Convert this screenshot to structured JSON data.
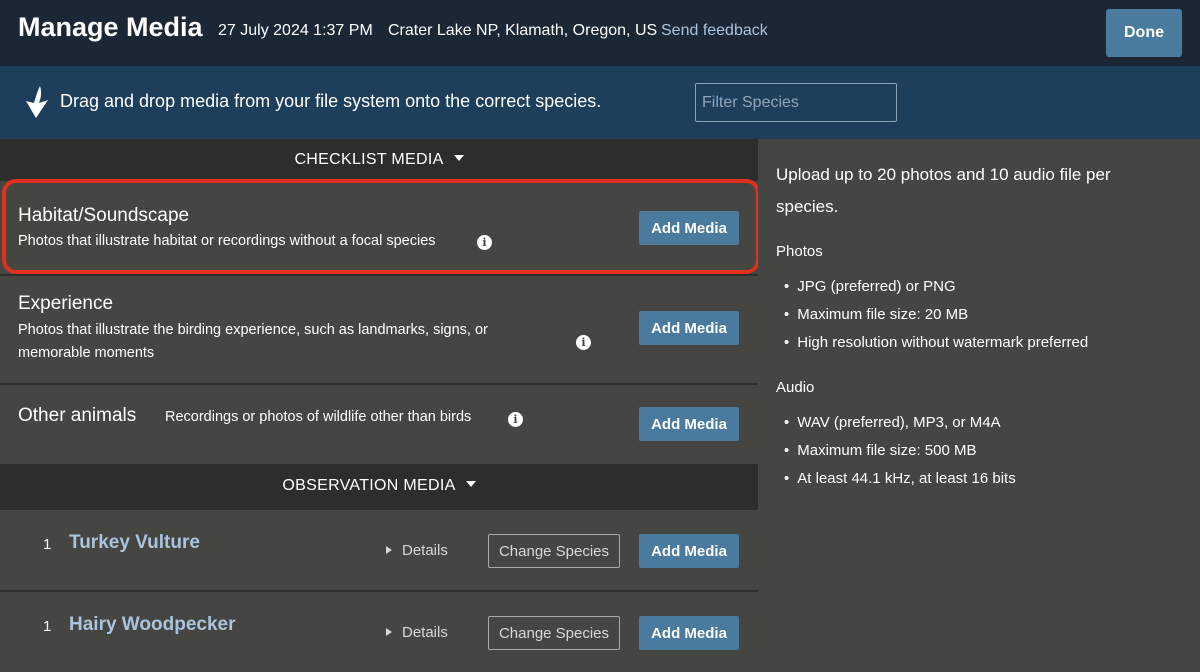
{
  "header": {
    "title": "Manage Media",
    "date": "27 July 2024 1:37 PM",
    "location": "Crater Lake NP, Klamath, Oregon, US",
    "feedback": "Send feedback",
    "done": "Done"
  },
  "dragbar": {
    "text": "Drag and drop media from your file system onto the correct species.",
    "filter_placeholder": "Filter Species"
  },
  "checklist_media": {
    "header": "CHECKLIST MEDIA",
    "rows": [
      {
        "title": "Habitat/Soundscape",
        "desc": "Photos that illustrate habitat or recordings without a focal species",
        "button": "Add Media"
      },
      {
        "title": "Experience",
        "desc": "Photos that illustrate the birding experience, such as landmarks, signs, or memorable moments",
        "button": "Add Media"
      },
      {
        "title": "Other animals",
        "desc": "Recordings or photos of wildlife other than birds",
        "button": "Add Media"
      }
    ]
  },
  "observation_media": {
    "header": "OBSERVATION MEDIA",
    "rows": [
      {
        "count": "1",
        "species": "Turkey Vulture",
        "details": "Details",
        "change": "Change Species",
        "button": "Add Media"
      },
      {
        "count": "1",
        "species": "Hairy Woodpecker",
        "details": "Details",
        "change": "Change Species",
        "button": "Add Media"
      }
    ]
  },
  "info_panel": {
    "intro": "Upload up to 20 photos and 10 audio file per species.",
    "photos_heading": "Photos",
    "photos": [
      "JPG (preferred) or PNG",
      "Maximum file size: 20 MB",
      "High resolution without watermark preferred"
    ],
    "audio_heading": "Audio",
    "audio": [
      "WAV (preferred), MP3, or M4A",
      "Maximum file size: 500 MB",
      "At least 44.1 kHz, at least 16 bits"
    ]
  },
  "colors": {
    "header_bg": "#1b2735",
    "dragbar_bg": "#1e3f5c",
    "button": "#4a7a9d",
    "link": "#a9c4dc",
    "highlight": "#e0301e"
  },
  "icons": [
    "download-arrow-icon",
    "caret-down-icon",
    "info-icon",
    "disclosure-triangle-icon"
  ]
}
